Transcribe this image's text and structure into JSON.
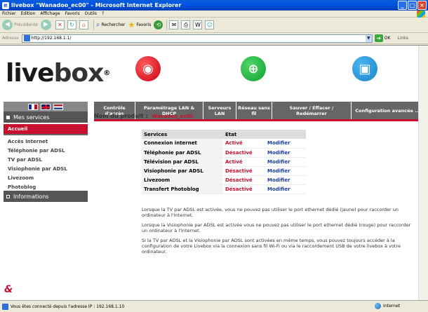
{
  "window": {
    "title": "livebox \"Wanadoo_ec00\" - Microsoft Internet Explorer",
    "buttons": [
      "_",
      "□",
      "×"
    ]
  },
  "menubar": [
    "Fichier",
    "Edition",
    "Affichage",
    "Favoris",
    "Outils",
    "?"
  ],
  "toolbar": {
    "back": "Précédente",
    "search": "Rechercher",
    "favorites": "Favoris"
  },
  "addressbar": {
    "label": "Adresse",
    "url": "http://192.168.1.1/",
    "go": "OK",
    "links": "Links"
  },
  "page": {
    "logo_part1": "live",
    "logo_part2": "box",
    "logo_reg": "®",
    "mes_services": "Mes services",
    "informations": "Informations",
    "nav": [
      "Contrôle d'accès",
      "Paramétrage LAN & DHCP",
      "Serveurs LAN",
      "Réseau sans fil",
      "Sauver / Effacer / Redémarrer",
      "Configuration avancée ..."
    ],
    "sidebar": [
      "Accueil",
      "Accès Internet",
      "Téléphonie par ADSL",
      "TV par ADSL",
      "Visiophonie par ADSL",
      "Livezoom",
      "Photoblog"
    ],
    "product_label": "Nom du produit :",
    "product_value": "Wanadoo_ec00",
    "table": {
      "headers": [
        "Services",
        "Etat",
        ""
      ],
      "rows": [
        {
          "service": "Connexion internet",
          "etat": "Activé",
          "action": "Modifier"
        },
        {
          "service": "Téléphonie par ADSL",
          "etat": "Désactivé",
          "action": "Modifier"
        },
        {
          "service": "Télévision par ADSL",
          "etat": "Activé",
          "action": "Modifier"
        },
        {
          "service": "Visiophonie par ADSL",
          "etat": "Désactivé",
          "action": "Modifier"
        },
        {
          "service": "Livezoom",
          "etat": "Désactivé",
          "action": "Modifier"
        },
        {
          "service": "Transfert Photoblog",
          "etat": "Désactivé",
          "action": "Modifier"
        }
      ]
    },
    "notes": [
      "Lorsque la TV par ADSL est activée, vous ne pouvez pas utiliser le port ethernet dédié (jaune) pour raccorder un ordinateur à l'Internet.",
      "Lorsque la Visiophonie par ADSL est activée vous ne pouvez pas utiliser le port ethernet dédié (rouge) pour raccorder un ordinateur à l'Internet.",
      "Si la TV par ADSL et la Visiophonie par ADSL sont activées en même temps, vous pouvez toujours accéder à la configuration de votre Livebox via la connexion sans fil Wi-Fi ou via le raccordement USB de votre livebox à votre ordinateur."
    ]
  },
  "statusbar": {
    "text": "Vous êtes connecté depuis l'adresse IP : 192.168.1.10",
    "zone": "Internet"
  }
}
